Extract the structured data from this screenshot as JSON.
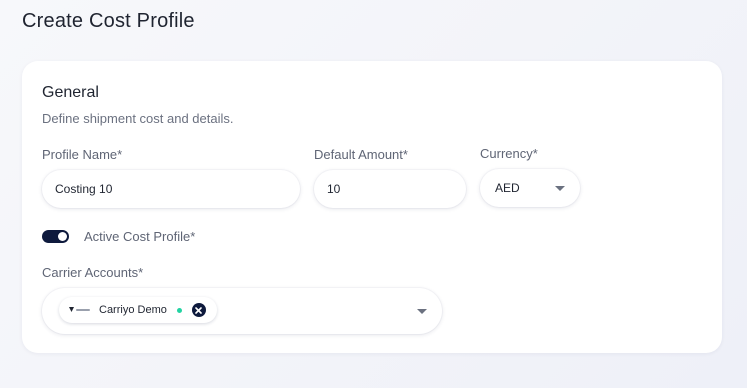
{
  "page": {
    "title": "Create Cost Profile"
  },
  "general": {
    "title": "General",
    "description": "Define shipment cost and details."
  },
  "fields": {
    "profile_name": {
      "label": "Profile Name*",
      "value": "Costing 10"
    },
    "default_amount": {
      "label": "Default Amount*",
      "value": "10"
    },
    "currency": {
      "label": "Currency*",
      "value": "AED"
    }
  },
  "active_toggle": {
    "label": "Active Cost Profile*",
    "state": "on"
  },
  "carrier_accounts": {
    "label": "Carrier Accounts*",
    "selected": [
      {
        "name": "Carriyo Demo",
        "status": "active",
        "status_color": "#22d3a2",
        "logo_icon": "carriyo-logo-icon"
      }
    ]
  },
  "colors": {
    "accent": "#0e1a3d",
    "status_active": "#22d3a2"
  }
}
